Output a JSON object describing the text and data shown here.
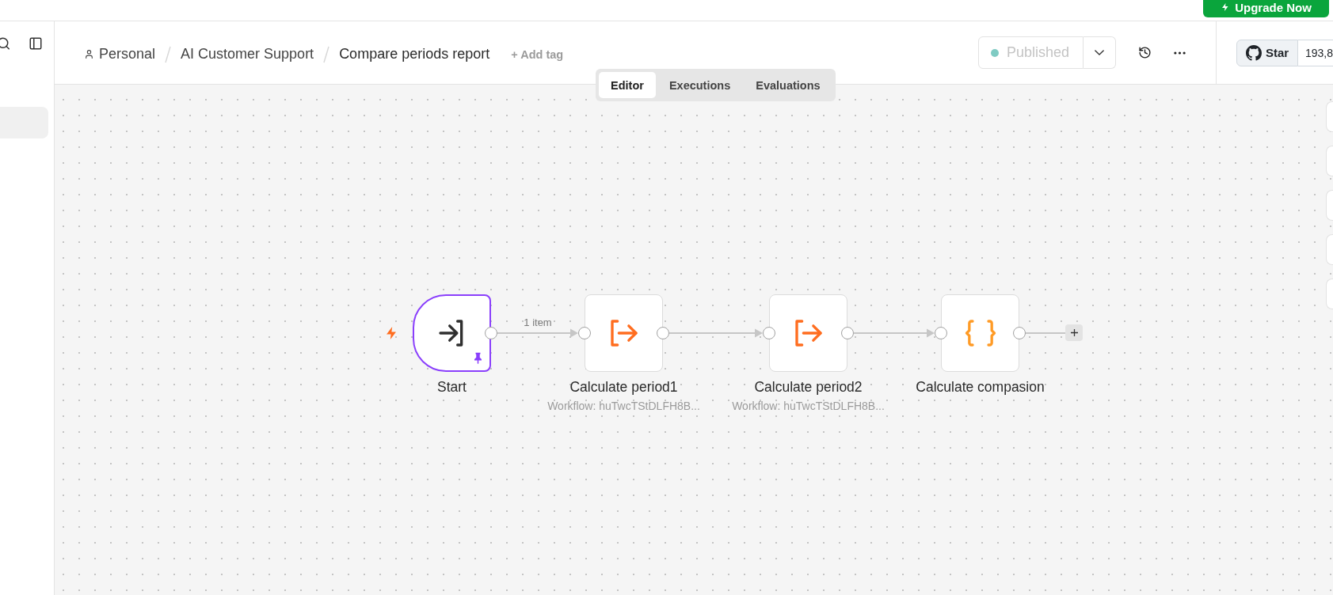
{
  "top_bar": {
    "upgrade_button": "Upgrade Now"
  },
  "sidebar": {
    "items": [
      {
        "selected": true
      }
    ]
  },
  "breadcrumb": [
    {
      "kind": "project",
      "label": "Personal"
    },
    {
      "kind": "folder",
      "label": "AI Customer Support"
    },
    {
      "kind": "workflow",
      "label": "Compare periods report"
    }
  ],
  "add_tag": "+ Add tag",
  "publish": {
    "label": "Published",
    "disabled": true
  },
  "tabs": [
    {
      "label": "Editor",
      "selected": true
    },
    {
      "label": "Executions",
      "selected": false
    },
    {
      "label": "Evaluations",
      "selected": false
    }
  ],
  "github": {
    "label": "Star",
    "count": "193,8"
  },
  "canvas": {
    "nodes": [
      {
        "kind": "trigger",
        "title": "Start",
        "pinned": true,
        "output_label": "1 item"
      },
      {
        "kind": "subworkflow",
        "title": "Calculate period1",
        "subtitle": "Workflow: huTwcTStDLFH8B...",
        "pinned": false
      },
      {
        "kind": "subworkflow",
        "title": "Calculate period2",
        "subtitle": "Workflow: huTwcTStDLFH8B...",
        "pinned": false
      },
      {
        "kind": "code",
        "title": "Calculate compasion",
        "pinned": false
      }
    ]
  }
}
